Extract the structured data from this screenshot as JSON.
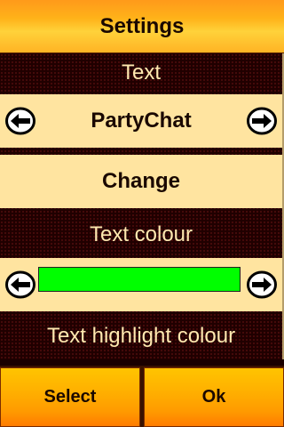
{
  "header": {
    "title": "Settings"
  },
  "sections": {
    "text": {
      "label": "Text",
      "value": "PartyChat"
    },
    "change": {
      "label": "Change"
    },
    "text_colour": {
      "label": "Text colour",
      "color": "#00ff00"
    },
    "highlight_colour": {
      "label": "Text highlight colour"
    }
  },
  "softkeys": {
    "left": "Select",
    "right": "Ok"
  },
  "colors": {
    "header_gradient": "#ffb219",
    "row_background": "#ffe4a0",
    "label_text": "#ffe9b0",
    "pattern_background": "#200000"
  },
  "icons": {
    "prev": "arrow-left-icon",
    "next": "arrow-right-icon"
  }
}
